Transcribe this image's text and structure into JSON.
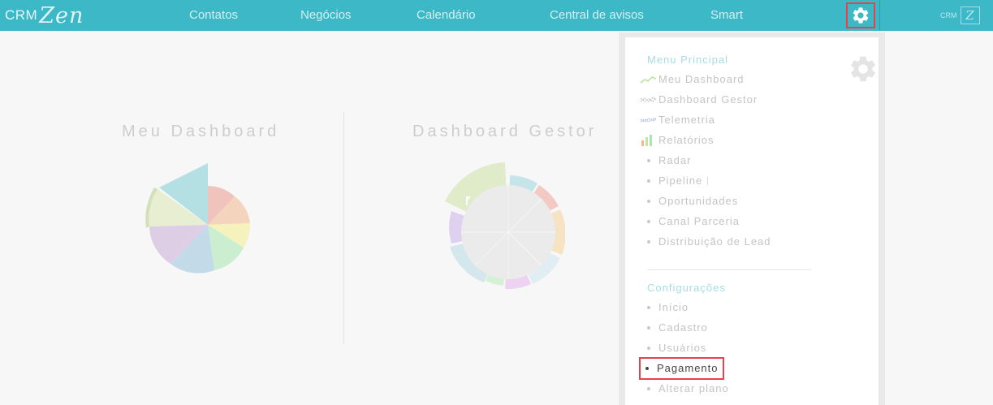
{
  "app": {
    "logo_crm": "CRM",
    "logo_zen": "Zen",
    "badge_crm": "CRM",
    "badge_z": "Z"
  },
  "nav": {
    "items": [
      {
        "label": "Contatos"
      },
      {
        "label": "Negócios"
      },
      {
        "label": "Calendário"
      },
      {
        "label": "Central de avisos"
      },
      {
        "label": "Smart"
      }
    ]
  },
  "dashboards": {
    "meu": {
      "title": "Meu Dashboard"
    },
    "gestor": {
      "title": "Dashboard Gestor"
    }
  },
  "menu": {
    "principal_title": "Menu Principal",
    "principal_items": [
      {
        "label": "Meu Dashboard",
        "icon": "line-chart-icon"
      },
      {
        "label": "Dashboard Gestor",
        "icon": "multi-line-chart-icon"
      },
      {
        "label": "Telemetria",
        "icon": "telemetry-chart-icon"
      },
      {
        "label": "Relatórios",
        "icon": "bar-chart-icon"
      },
      {
        "label": "Radar",
        "icon": "bullet"
      },
      {
        "label": "Pipeline",
        "icon": "bullet"
      },
      {
        "label": "Oportunidades",
        "icon": "bullet"
      },
      {
        "label": "Canal Parceria",
        "icon": "bullet"
      },
      {
        "label": "Distribuição de Lead",
        "icon": "bullet"
      }
    ],
    "config_title": "Configurações",
    "config_items": [
      {
        "label": "Início"
      },
      {
        "label": "Cadastro"
      },
      {
        "label": "Usuários"
      },
      {
        "label": "Pagamento",
        "active": true
      },
      {
        "label": "Alterar plano"
      }
    ]
  },
  "colors": {
    "topbar": "#3db8c6",
    "highlight": "#e8434a",
    "section_title": "#a6dde5"
  }
}
